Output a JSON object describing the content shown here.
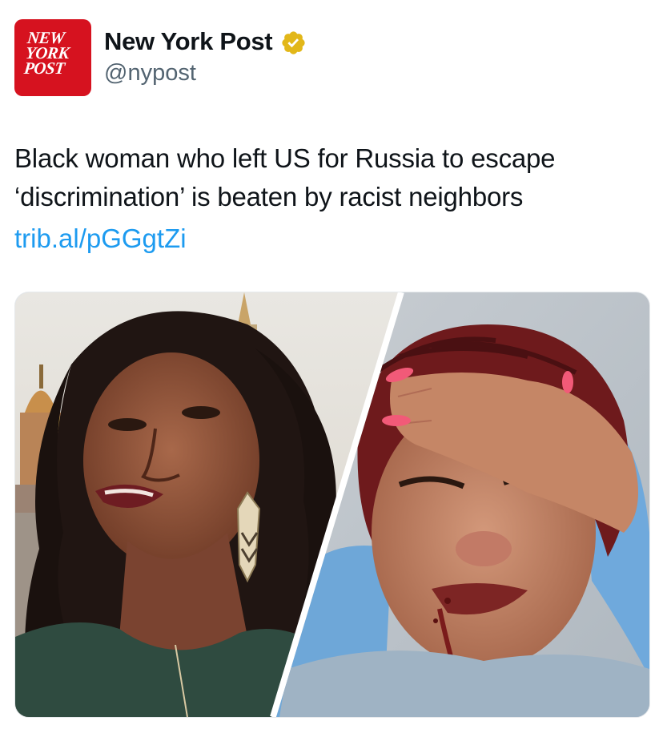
{
  "account": {
    "name": "New York Post",
    "handle": "@nypost",
    "verified": true,
    "avatar_lines": [
      "NEW",
      "YORK",
      "POST"
    ],
    "avatar_color": "#d6121f",
    "badge_color": "#e2b719"
  },
  "tweet": {
    "text_lines": [
      "Black woman who left US for Russia to escape",
      "‘discrimination’ is beaten by racist neighbors"
    ],
    "link": "trib.al/pGGgtZi",
    "link_color": "#1d9bf0"
  },
  "media": {
    "panels": [
      {
        "subject": "smiling-woman-portrait"
      },
      {
        "subject": "injured-woman-selfie"
      }
    ]
  }
}
